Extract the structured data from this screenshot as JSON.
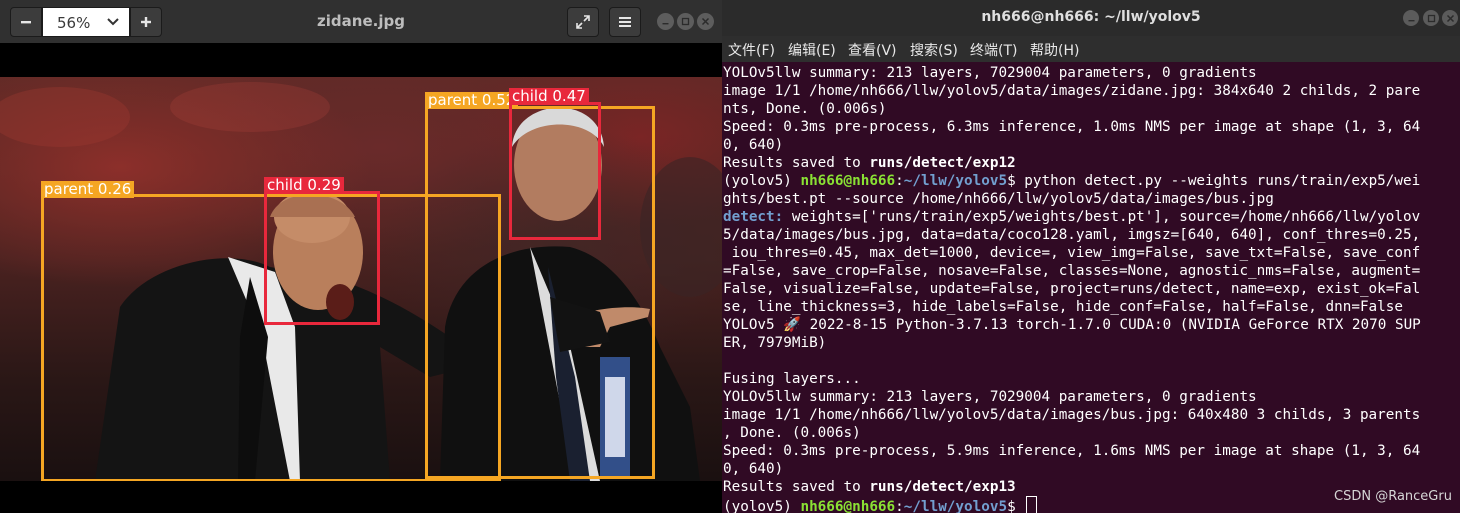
{
  "viewer": {
    "title": "zidane.jpg",
    "zoom": "56%",
    "detections": [
      {
        "label": "parent 0.26"
      },
      {
        "label": "child 0.29"
      },
      {
        "label": "parent 0.52"
      },
      {
        "label": "child 0.47"
      }
    ],
    "colors": {
      "parent": "#f5a623",
      "child": "#e8283c"
    }
  },
  "terminal": {
    "title": "nh666@nh666: ~/llw/yolov5",
    "menu": [
      "文件(F)",
      "编辑(E)",
      "查看(V)",
      "搜索(S)",
      "终端(T)",
      "帮助(H)"
    ],
    "prompt_env": "(yolov5) ",
    "prompt_user": "nh666@nh666",
    "prompt_sep": ":",
    "prompt_path": "~/llw/yolov5",
    "prompt_dollar": "$",
    "lines": [
      "YOLOv5llw summary: 213 layers, 7029004 parameters, 0 gradients",
      "image 1/1 /home/nh666/llw/yolov5/data/images/zidane.jpg: 384x640 2 childs, 2 pare",
      "nts, Done. (0.006s)",
      "Speed: 0.3ms pre-process, 6.3ms inference, 1.0ms NMS per image at shape (1, 3, 64",
      "0, 640)",
      "Results saved to ",
      "runs/detect/exp12",
      " python detect.py --weights runs/train/exp5/wei",
      "ghts/best.pt --source /home/nh666/llw/yolov5/data/images/bus.jpg",
      "detect:",
      " weights=['runs/train/exp5/weights/best.pt'], source=/home/nh666/llw/yolov",
      "5/data/images/bus.jpg, data=data/coco128.yaml, imgsz=[640, 640], conf_thres=0.25,",
      " iou_thres=0.45, max_det=1000, device=, view_img=False, save_txt=False, save_conf",
      "=False, save_crop=False, nosave=False, classes=None, agnostic_nms=False, augment=",
      "False, visualize=False, update=False, project=runs/detect, name=exp, exist_ok=Fal",
      "se, line_thickness=3, hide_labels=False, hide_conf=False, half=False, dnn=False",
      "YOLOv5 🚀 2022-8-15 Python-3.7.13 torch-1.7.0 CUDA:0 (NVIDIA GeForce RTX 2070 SUP",
      "ER, 7979MiB)",
      "Fusing layers...",
      "YOLOv5llw summary: 213 layers, 7029004 parameters, 0 gradients",
      "image 1/1 /home/nh666/llw/yolov5/data/images/bus.jpg: 640x480 3 childs, 3 parents",
      ", Done. (0.006s)",
      "Speed: 0.3ms pre-process, 5.9ms inference, 1.6ms NMS per image at shape (1, 3, 64",
      "0, 640)",
      "Results saved to ",
      "runs/detect/exp13"
    ],
    "watermark": "CSDN @RanceGru"
  }
}
